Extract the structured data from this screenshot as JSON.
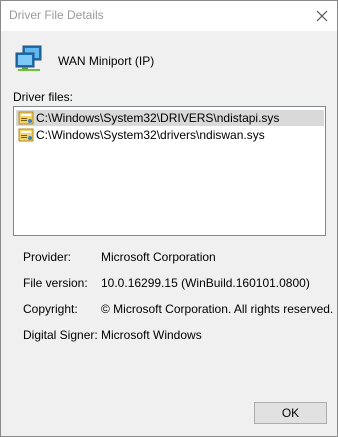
{
  "window": {
    "title": "Driver File Details"
  },
  "device": {
    "name": "WAN Miniport (IP)",
    "icon": "network-adapter-icon"
  },
  "driver_files": {
    "label": "Driver files:",
    "items": [
      {
        "path": "C:\\Windows\\System32\\DRIVERS\\ndistapi.sys",
        "selected": true
      },
      {
        "path": "C:\\Windows\\System32\\drivers\\ndiswan.sys",
        "selected": false
      }
    ]
  },
  "details": {
    "provider_label": "Provider:",
    "provider_value": "Microsoft Corporation",
    "version_label": "File version:",
    "version_value": "10.0.16299.15 (WinBuild.160101.0800)",
    "copyright_label": "Copyright:",
    "copyright_value": "© Microsoft Corporation. All rights reserved.",
    "signer_label": "Digital Signer:",
    "signer_value": "Microsoft Windows"
  },
  "buttons": {
    "ok_label": "OK"
  }
}
